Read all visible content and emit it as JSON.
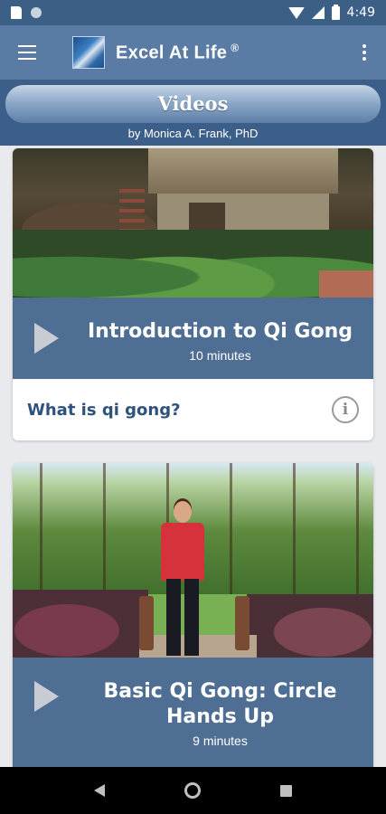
{
  "status_bar": {
    "time": "4:49",
    "icons": [
      "sd-card-icon",
      "notification-dot-icon",
      "wifi-icon",
      "signal-icon",
      "battery-icon"
    ]
  },
  "app_bar": {
    "title": "Excel At Life",
    "registered_mark": "®",
    "icons": [
      "menu-icon",
      "app-logo-icon",
      "overflow-menu-icon"
    ]
  },
  "header": {
    "title": "Videos",
    "byline": "by Monica A. Frank, PhD"
  },
  "videos": [
    {
      "title": "Introduction to Qi Gong",
      "duration": "10 minutes",
      "question": "What is qi gong?",
      "icon": "play-icon"
    },
    {
      "title": "Basic Qi Gong: Circle Hands Up",
      "duration": "9 minutes",
      "icon": "play-icon"
    }
  ],
  "nav_bar": {
    "icons": [
      "back-icon",
      "home-icon",
      "recents-icon"
    ]
  },
  "colors": {
    "status_bar": "#3c5f86",
    "app_bar": "#5a7ba3",
    "header_band": "#3b5f88",
    "play_bar": "#4f6e94",
    "question_text": "#2e527d"
  }
}
